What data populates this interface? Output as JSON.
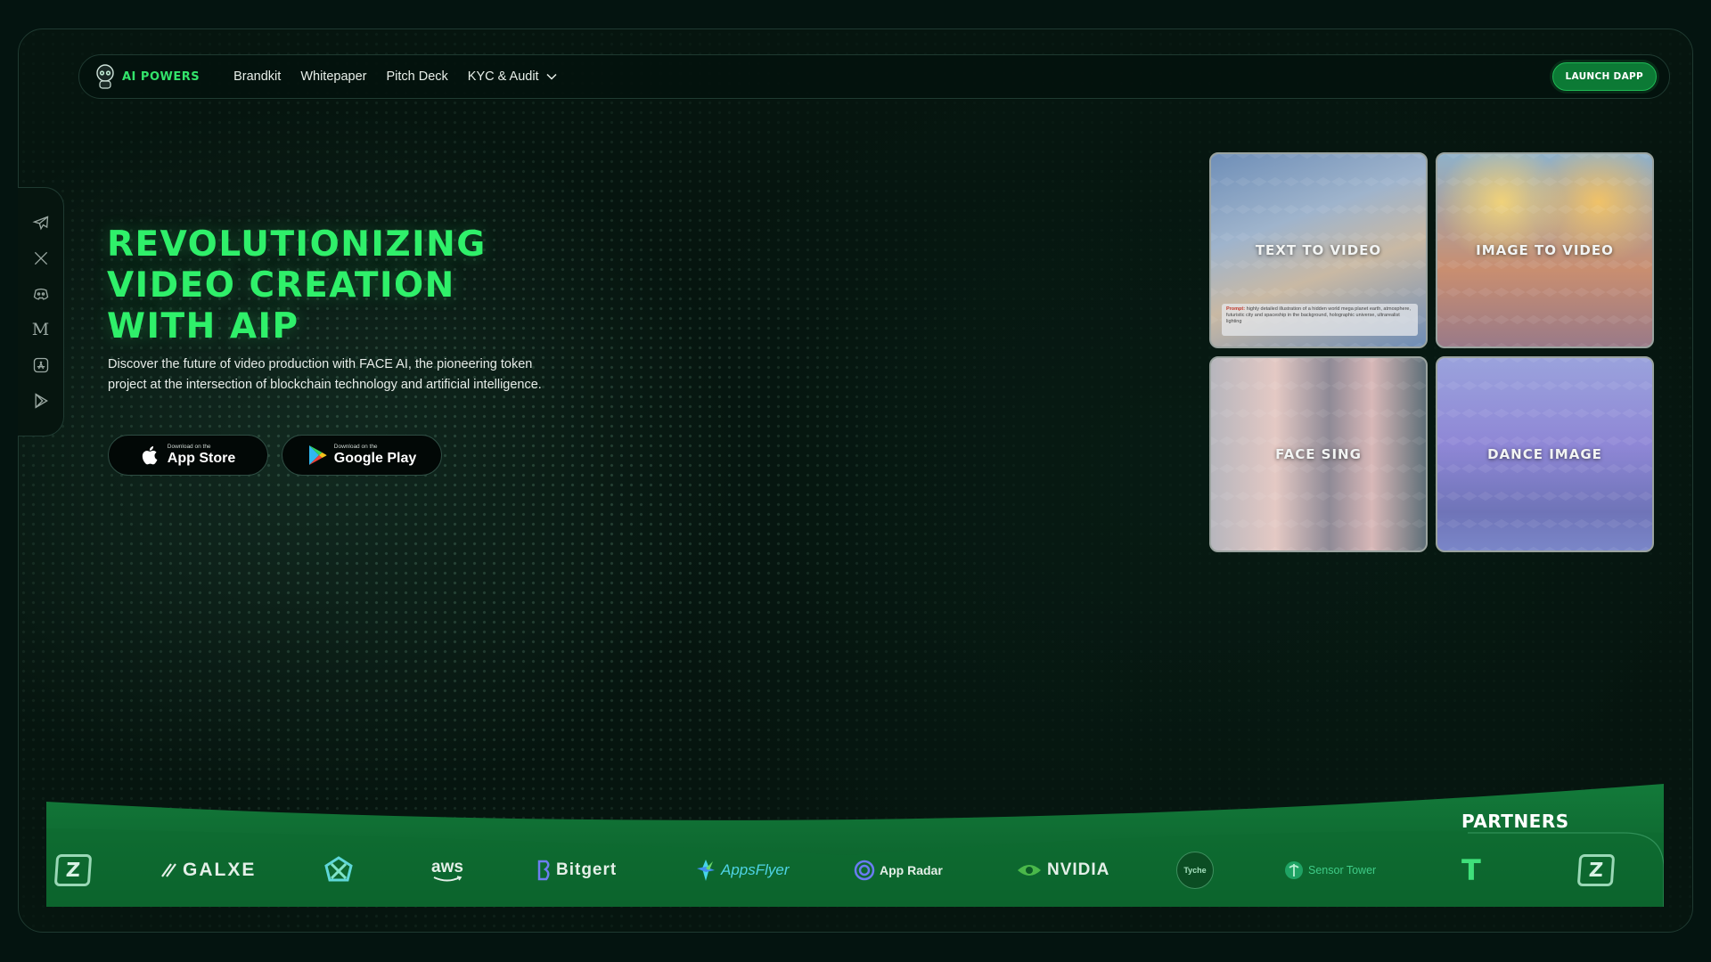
{
  "brand": {
    "name": "AI POWERS"
  },
  "nav": {
    "links": [
      "Brandkit",
      "Whitepaper",
      "Pitch Deck",
      "KYC & Audit"
    ],
    "launch_label": "LAUNCH DAPP"
  },
  "social": [
    "telegram-icon",
    "x-icon",
    "discord-icon",
    "medium-icon",
    "app-store-icon",
    "google-play-icon"
  ],
  "hero": {
    "title_lines": [
      "REVOLUTIONIZING",
      "VIDEO CREATION",
      "WITH AIP"
    ],
    "description": "Discover the future of video production with FACE AI, the pioneering token project at the intersection of blockchain technology and artificial intelligence.",
    "buttons": [
      {
        "small": "Download on the",
        "big": "App Store",
        "icon": "apple-icon"
      },
      {
        "small": "Download on the",
        "big": "Google Play",
        "icon": "google-play-icon"
      }
    ]
  },
  "features": [
    {
      "label": "TEXT TO VIDEO",
      "prompt_label": "Prompt:",
      "prompt": "highly detailed illustration of a hidden world mega planet earth, atmosphere, futuristic city and spaceship in the background, holographic universe, ultrarealist lighting"
    },
    {
      "label": "IMAGE TO VIDEO"
    },
    {
      "label": "FACE SING"
    },
    {
      "label": "DANCE IMAGE"
    }
  ],
  "partners": {
    "title": "PARTNERS",
    "items": [
      "Z",
      "GALXE",
      "",
      "aws",
      "Bitgert",
      "AppsFlyer",
      "App Radar",
      "NVIDIA",
      "Tyche",
      "Sensor Tower",
      "T",
      "Z"
    ]
  },
  "colors": {
    "accent": "#2ff06a",
    "band": "#0e6a30",
    "launch": "#0c7a35"
  }
}
